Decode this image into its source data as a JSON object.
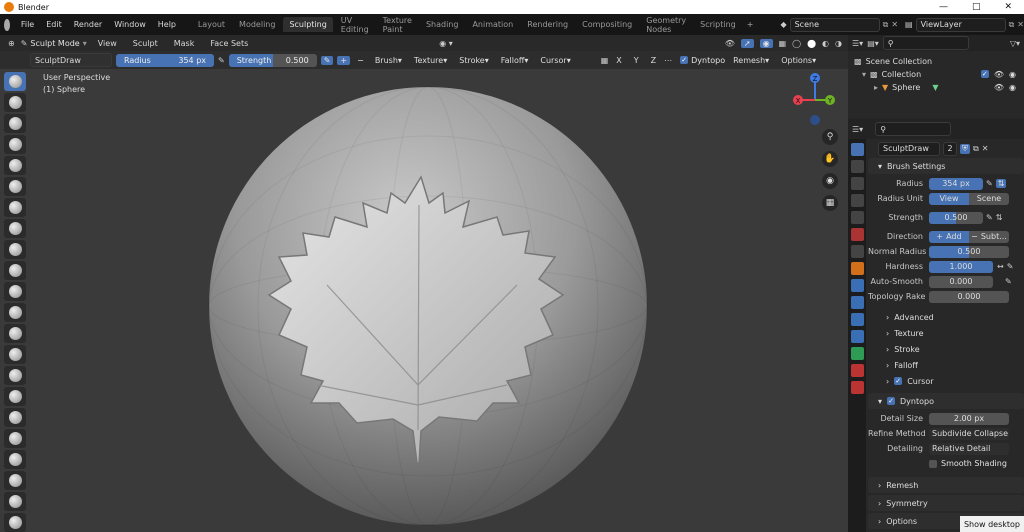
{
  "app": {
    "title": "Blender"
  },
  "menu": [
    "File",
    "Edit",
    "Render",
    "Window",
    "Help"
  ],
  "workspaces": [
    "Layout",
    "Modeling",
    "Sculpting",
    "UV Editing",
    "Texture Paint",
    "Shading",
    "Animation",
    "Rendering",
    "Compositing",
    "Geometry Nodes",
    "Scripting"
  ],
  "active_workspace": "Sculpting",
  "scene": {
    "name": "Scene",
    "view_layer": "ViewLayer"
  },
  "viewport": {
    "mode": "Sculpt Mode",
    "menus": [
      "View",
      "Sculpt",
      "Mask",
      "Face Sets"
    ],
    "info_line1": "User Perspective",
    "info_line2": "(1) Sphere"
  },
  "tool_header": {
    "brush": "SculptDraw",
    "radius_label": "Radius",
    "radius_value": "354 px",
    "strength_label": "Strength",
    "strength_value": "0.500",
    "strength_fraction": 0.5,
    "menus": [
      "Brush",
      "Texture",
      "Stroke",
      "Falloff",
      "Cursor"
    ],
    "axes": [
      "X",
      "Y",
      "Z"
    ],
    "dyntopo": "Dyntopo",
    "remesh": "Remesh",
    "options": "Options"
  },
  "outliner": {
    "scene_collection": "Scene Collection",
    "collection": "Collection",
    "object": "Sphere"
  },
  "properties": {
    "brush_name": "SculptDraw",
    "brush_users": "2",
    "brush_settings": "Brush Settings",
    "radius_label": "Radius",
    "radius_value": "354 px",
    "radius_unit_label": "Radius Unit",
    "unit_view": "View",
    "unit_scene": "Scene",
    "strength_label": "Strength",
    "strength_value": "0.500",
    "strength_fraction": 0.5,
    "direction_label": "Direction",
    "dir_add": "Add",
    "dir_sub": "Subt...",
    "normal_radius_label": "Normal Radius",
    "normal_radius_value": "0.500",
    "normal_radius_fraction": 0.5,
    "hardness_label": "Hardness",
    "hardness_value": "1.000",
    "hardness_fraction": 1.0,
    "autosmooth_label": "Auto-Smooth",
    "autosmooth_value": "0.000",
    "topology_rake_label": "Topology Rake",
    "topology_rake_value": "0.000",
    "subpanels": [
      "Advanced",
      "Texture",
      "Stroke",
      "Falloff"
    ],
    "cursor": "Cursor",
    "dyntopo": "Dyntopo",
    "detail_size_label": "Detail Size",
    "detail_size_value": "2.00 px",
    "refine_label": "Refine Method",
    "refine_value": "Subdivide Collapse",
    "detailing_label": "Detailing",
    "detailing_value": "Relative Detail",
    "smooth_shading": "Smooth Shading",
    "remesh": "Remesh",
    "symmetry": "Symmetry",
    "options": "Options"
  },
  "taskbar": {
    "show_desktop": "Show desktop"
  },
  "colors": {
    "accent": "#4772b3",
    "gizmo_x": "#e8404f",
    "gizmo_y": "#6fb223",
    "gizmo_z": "#3d7ce6"
  }
}
